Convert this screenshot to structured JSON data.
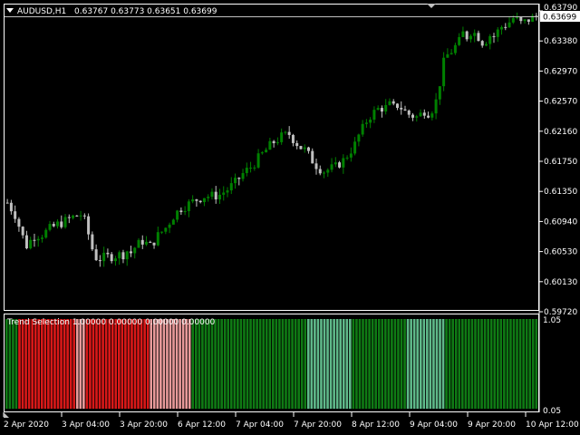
{
  "main": {
    "title": "AUDUSD,H1",
    "ohlc": "0.63767 0.63773 0.63651 0.63699",
    "current_price": "0.63699",
    "price_labels": [
      "0.63790",
      "0.63380",
      "0.62970",
      "0.62570",
      "0.62160",
      "0.61750",
      "0.61350",
      "0.60940",
      "0.60530",
      "0.60130",
      "0.59720"
    ],
    "colors": {
      "bull": "#008000",
      "bear": "#c0c0c0",
      "grid_line": "#ffffff"
    }
  },
  "indicator": {
    "title": "Trend Selection 1.00000 0.00000 0.00000 0.00000",
    "scale_top": "1.05",
    "scale_bottom": "0.05",
    "colors": {
      "strong_up": "#0f7a14",
      "weak_up": "#5fb98a",
      "strong_down": "#d81818",
      "weak_down": "#e89a9a"
    }
  },
  "time_axis": {
    "labels": [
      "2 Apr 2020",
      "3 Apr 04:00",
      "3 Apr 20:00",
      "6 Apr 12:00",
      "7 Apr 04:00",
      "7 Apr 20:00",
      "8 Apr 12:00",
      "9 Apr 04:00",
      "9 Apr 20:00",
      "10 Apr 12:00"
    ]
  },
  "chart_data": {
    "type": "candlestick",
    "symbol": "AUDUSD",
    "timeframe": "H1",
    "ylim": [
      0.5972,
      0.6379
    ],
    "close_path": [
      [
        0,
        0.6088
      ],
      [
        2,
        0.607
      ],
      [
        4,
        0.6036
      ],
      [
        5,
        0.6023
      ],
      [
        7,
        0.6038
      ],
      [
        9,
        0.604
      ],
      [
        11,
        0.6048
      ],
      [
        13,
        0.6055
      ],
      [
        15,
        0.606
      ],
      [
        17,
        0.6066
      ],
      [
        19,
        0.607
      ],
      [
        20,
        0.606
      ],
      [
        21,
        0.604
      ],
      [
        22,
        0.6018
      ],
      [
        23,
        0.6005
      ],
      [
        24,
        0.6003
      ],
      [
        26,
        0.6006
      ],
      [
        28,
        0.6008
      ],
      [
        30,
        0.601
      ],
      [
        31,
        0.6015
      ],
      [
        32,
        0.6012
      ],
      [
        33,
        0.602
      ],
      [
        35,
        0.603
      ],
      [
        37,
        0.6022
      ],
      [
        39,
        0.6038
      ],
      [
        41,
        0.605
      ],
      [
        43,
        0.6068
      ],
      [
        45,
        0.608
      ],
      [
        47,
        0.6086
      ],
      [
        49,
        0.6093
      ],
      [
        51,
        0.6098
      ],
      [
        53,
        0.6098
      ],
      [
        55,
        0.61
      ],
      [
        57,
        0.6108
      ],
      [
        59,
        0.6118
      ],
      [
        61,
        0.6132
      ],
      [
        63,
        0.6142
      ],
      [
        65,
        0.6155
      ],
      [
        67,
        0.6168
      ],
      [
        69,
        0.618
      ],
      [
        71,
        0.6188
      ],
      [
        73,
        0.6192
      ],
      [
        74,
        0.6185
      ],
      [
        75,
        0.6178
      ],
      [
        76,
        0.6172
      ],
      [
        77,
        0.6168
      ],
      [
        78,
        0.616
      ],
      [
        79,
        0.6152
      ],
      [
        80,
        0.6145
      ],
      [
        81,
        0.614
      ],
      [
        82,
        0.6136
      ],
      [
        83,
        0.6138
      ],
      [
        84,
        0.614
      ],
      [
        85,
        0.6142
      ],
      [
        86,
        0.6148
      ],
      [
        87,
        0.6152
      ],
      [
        88,
        0.616
      ],
      [
        89,
        0.6168
      ],
      [
        90,
        0.6176
      ],
      [
        91,
        0.619
      ],
      [
        92,
        0.62
      ],
      [
        93,
        0.6212
      ],
      [
        94,
        0.622
      ],
      [
        95,
        0.6225
      ],
      [
        96,
        0.623
      ],
      [
        97,
        0.6232
      ],
      [
        98,
        0.6232
      ],
      [
        99,
        0.6236
      ],
      [
        100,
        0.6232
      ],
      [
        101,
        0.6236
      ],
      [
        102,
        0.6232
      ],
      [
        103,
        0.6226
      ],
      [
        104,
        0.6222
      ],
      [
        105,
        0.622
      ],
      [
        106,
        0.6218
      ],
      [
        107,
        0.6222
      ],
      [
        108,
        0.6228
      ],
      [
        109,
        0.6225
      ],
      [
        110,
        0.623
      ],
      [
        111,
        0.6242
      ],
      [
        112,
        0.627
      ],
      [
        113,
        0.63
      ],
      [
        114,
        0.6312
      ],
      [
        115,
        0.6318
      ],
      [
        116,
        0.6325
      ],
      [
        117,
        0.6332
      ],
      [
        118,
        0.6345
      ],
      [
        119,
        0.634
      ],
      [
        120,
        0.6348
      ],
      [
        121,
        0.6345
      ],
      [
        122,
        0.634
      ],
      [
        123,
        0.6332
      ],
      [
        124,
        0.6335
      ],
      [
        125,
        0.6342
      ],
      [
        126,
        0.634
      ],
      [
        127,
        0.6348
      ],
      [
        128,
        0.6355
      ],
      [
        129,
        0.6358
      ],
      [
        130,
        0.6362
      ],
      [
        131,
        0.6368
      ],
      [
        132,
        0.6365
      ],
      [
        133,
        0.636
      ],
      [
        134,
        0.6362
      ],
      [
        135,
        0.6366
      ],
      [
        136,
        0.6368
      ],
      [
        137,
        0.637
      ]
    ],
    "indicator_segments": [
      {
        "state": "strong_up",
        "from": 0,
        "to": 4
      },
      {
        "state": "strong_down",
        "from": 4,
        "to": 22
      },
      {
        "state": "weak_down",
        "from": 22,
        "to": 25
      },
      {
        "state": "strong_down",
        "from": 25,
        "to": 45
      },
      {
        "state": "weak_down",
        "from": 45,
        "to": 58
      },
      {
        "state": "strong_up",
        "from": 58,
        "to": 94
      },
      {
        "state": "weak_up",
        "from": 94,
        "to": 108
      },
      {
        "state": "strong_up",
        "from": 108,
        "to": 125
      },
      {
        "state": "weak_up",
        "from": 125,
        "to": 137
      },
      {
        "state": "strong_up",
        "from": 137,
        "to": 166
      }
    ]
  }
}
